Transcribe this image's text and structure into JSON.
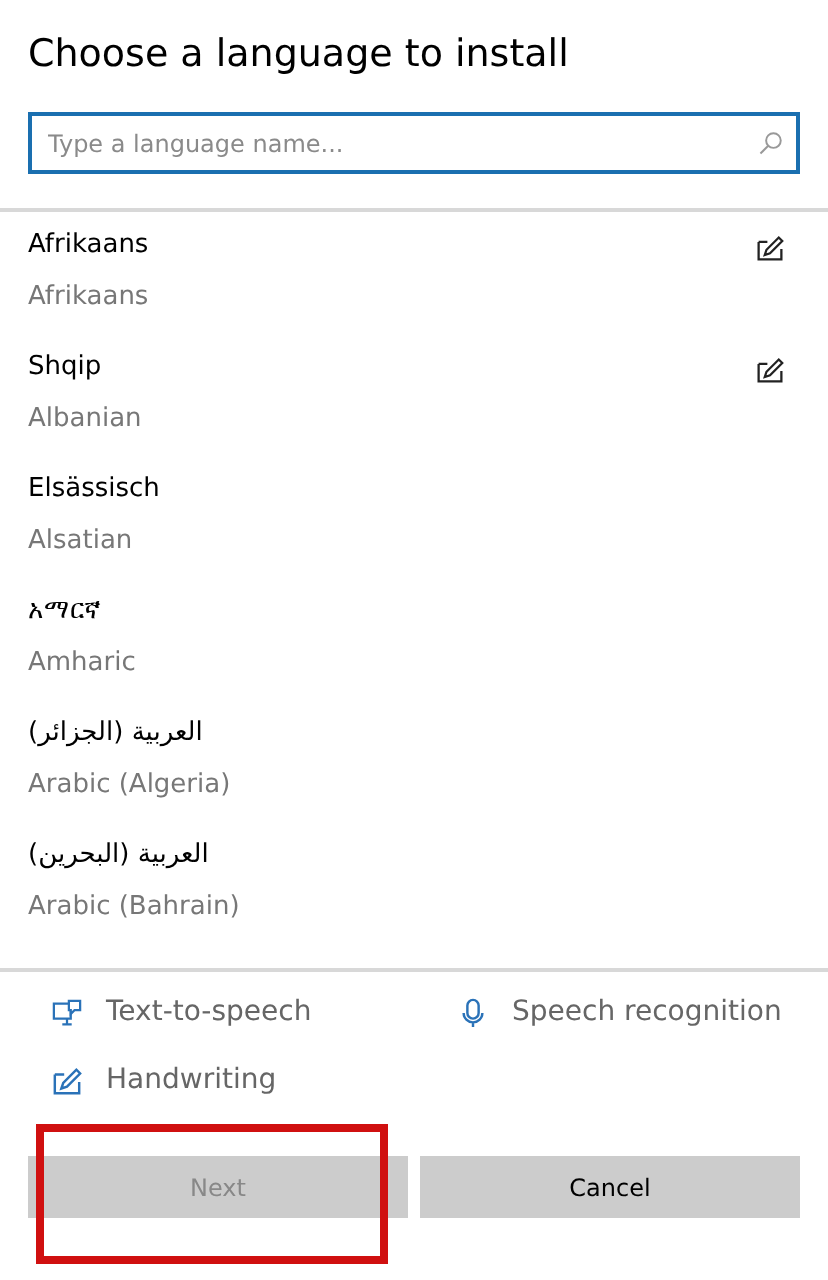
{
  "title": "Choose a language to install",
  "search": {
    "placeholder": "Type a language name..."
  },
  "languages": [
    {
      "native": "Afrikaans",
      "english": "Afrikaans",
      "handwriting": true
    },
    {
      "native": "Shqip",
      "english": "Albanian",
      "handwriting": true
    },
    {
      "native": "Elsässisch",
      "english": "Alsatian",
      "handwriting": false
    },
    {
      "native": "አማርኛ",
      "english": "Amharic",
      "handwriting": false
    },
    {
      "native": "العربية (الجزائر)",
      "english": "Arabic (Algeria)",
      "handwriting": false
    },
    {
      "native": "العربية (البحرين)",
      "english": "Arabic (Bahrain)",
      "handwriting": false
    }
  ],
  "features": [
    {
      "kind": "tts",
      "label": "Text-to-speech"
    },
    {
      "kind": "speech",
      "label": "Speech recognition"
    },
    {
      "kind": "handwriting",
      "label": "Handwriting"
    }
  ],
  "buttons": [
    {
      "label": "Next",
      "disabled": true,
      "highlighted": true
    },
    {
      "label": "Cancel",
      "disabled": false,
      "highlighted": false
    }
  ]
}
